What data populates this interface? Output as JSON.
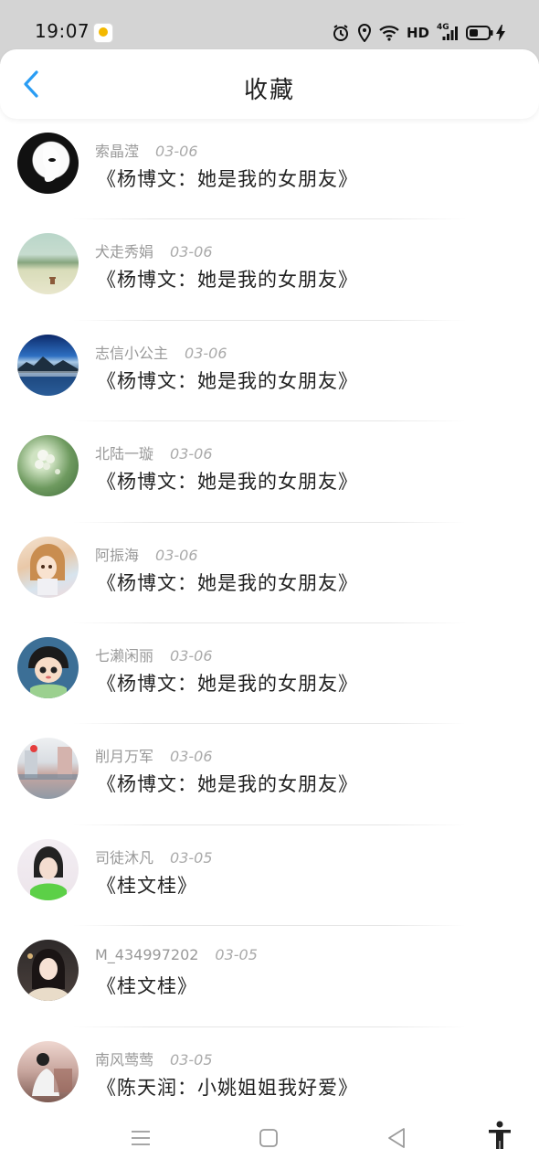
{
  "status_bar": {
    "time": "19:07",
    "hd_label": "HD",
    "network_label": "4G",
    "icons": [
      "app-notification-icon",
      "alarm-icon",
      "location-icon",
      "wifi-icon",
      "signal-icon",
      "battery-icon",
      "charging-icon"
    ]
  },
  "header": {
    "title": "收藏",
    "back_icon": "chevron-left-icon",
    "accent_color": "#2a9df4"
  },
  "favorites": [
    {
      "user": "索晶滢",
      "date": "03-06",
      "song": "《杨博文：她是我的女朋友》",
      "avatar": "mask-avatar"
    },
    {
      "user": "犬走秀娟",
      "date": "03-06",
      "song": "《杨博文：她是我的女朋友》",
      "avatar": "field-avatar"
    },
    {
      "user": "志信小公主",
      "date": "03-06",
      "song": "《杨博文：她是我的女朋友》",
      "avatar": "lake-avatar"
    },
    {
      "user": "北陆一璇",
      "date": "03-06",
      "song": "《杨博文：她是我的女朋友》",
      "avatar": "flower-avatar"
    },
    {
      "user": "阿振海",
      "date": "03-06",
      "song": "《杨博文：她是我的女朋友》",
      "avatar": "anime-girl-avatar"
    },
    {
      "user": "七濑闲丽",
      "date": "03-06",
      "song": "《杨博文：她是我的女朋友》",
      "avatar": "cartoon-kid-avatar"
    },
    {
      "user": "削月万军",
      "date": "03-06",
      "song": "《杨博文：她是我的女朋友》",
      "avatar": "street-avatar"
    },
    {
      "user": "司徒沐凡",
      "date": "03-05",
      "song": "《桂文桂》",
      "avatar": "girl-green-avatar"
    },
    {
      "user": "M_434997202",
      "date": "03-05",
      "song": "《桂文桂》",
      "avatar": "girl-portrait-avatar"
    },
    {
      "user": "南风莺莺",
      "date": "03-05",
      "song": "《陈天润：小姚姐姐我好爱》",
      "avatar": "room-avatar"
    }
  ],
  "nav_bar": {
    "icons": [
      "menu-icon",
      "home-square-icon",
      "back-triangle-icon",
      "accessibility-icon"
    ]
  }
}
